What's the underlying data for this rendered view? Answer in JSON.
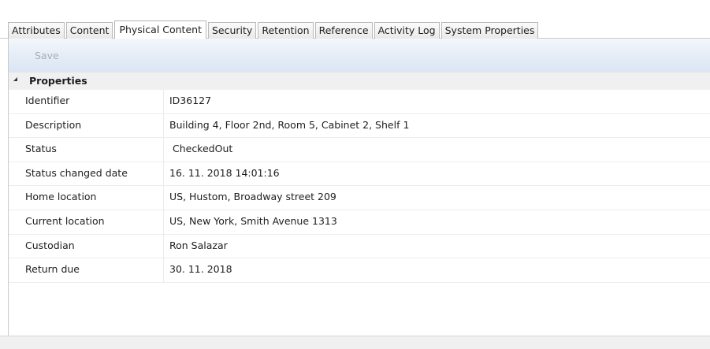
{
  "tabs": [
    {
      "label": "Attributes",
      "active": false
    },
    {
      "label": "Content",
      "active": false
    },
    {
      "label": "Physical Content",
      "active": true
    },
    {
      "label": "Security",
      "active": false
    },
    {
      "label": "Retention",
      "active": false
    },
    {
      "label": "Reference",
      "active": false
    },
    {
      "label": "Activity Log",
      "active": false
    },
    {
      "label": "System Properties",
      "active": false
    }
  ],
  "toolbar": {
    "save_label": "Save",
    "save_enabled": false
  },
  "properties": {
    "group_title": "Properties",
    "rows": [
      {
        "label": "Identifier",
        "value": "ID36127"
      },
      {
        "label": "Description",
        "value": "Building 4, Floor 2nd, Room 5, Cabinet 2, Shelf 1"
      },
      {
        "label": "Status",
        "value": " CheckedOut"
      },
      {
        "label": "Status changed date",
        "value": "16. 11. 2018 14:01:16"
      },
      {
        "label": "Home location",
        "value": "US, Hustom, Broadway street 209"
      },
      {
        "label": "Current location",
        "value": "US, New York, Smith Avenue 1313"
      },
      {
        "label": "Custodian",
        "value": "Ron Salazar"
      },
      {
        "label": "Return due",
        "value": "30. 11. 2018"
      }
    ]
  },
  "colors": {
    "toolbar_gradient_top": "#f4f7fc",
    "toolbar_gradient_bottom": "#dbe5f3",
    "disabled_text": "#a8adb3",
    "group_header_bg": "#f0f0f0"
  }
}
